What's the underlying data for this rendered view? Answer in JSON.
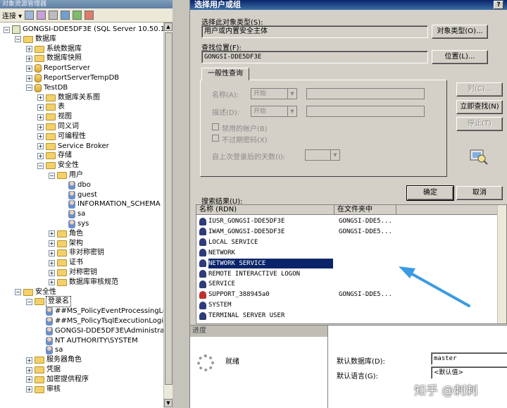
{
  "explorer": {
    "title": "对象资源管理器",
    "toolbar": {
      "connect_label": "连接 ▾"
    },
    "tree": [
      {
        "label": "GONGSI-DDE5DF3E (SQL Server 10.50.160",
        "level": 0,
        "expander": "-",
        "icon": "server"
      },
      {
        "label": "数据库",
        "level": 1,
        "expander": "-",
        "icon": "folder"
      },
      {
        "label": "系统数据库",
        "level": 2,
        "expander": "+",
        "icon": "folder"
      },
      {
        "label": "数据库快照",
        "level": 2,
        "expander": "+",
        "icon": "folder"
      },
      {
        "label": "ReportServer",
        "level": 2,
        "expander": "+",
        "icon": "database"
      },
      {
        "label": "ReportServerTempDB",
        "level": 2,
        "expander": "+",
        "icon": "database"
      },
      {
        "label": "TestDB",
        "level": 2,
        "expander": "-",
        "icon": "database"
      },
      {
        "label": "数据库关系图",
        "level": 3,
        "expander": "+",
        "icon": "folder"
      },
      {
        "label": "表",
        "level": 3,
        "expander": "+",
        "icon": "folder"
      },
      {
        "label": "视图",
        "level": 3,
        "expander": "+",
        "icon": "folder"
      },
      {
        "label": "同义词",
        "level": 3,
        "expander": "+",
        "icon": "folder"
      },
      {
        "label": "可编程性",
        "level": 3,
        "expander": "+",
        "icon": "folder"
      },
      {
        "label": "Service Broker",
        "level": 3,
        "expander": "+",
        "icon": "folder"
      },
      {
        "label": "存储",
        "level": 3,
        "expander": "+",
        "icon": "folder"
      },
      {
        "label": "安全性",
        "level": 3,
        "expander": "-",
        "icon": "folder"
      },
      {
        "label": "用户",
        "level": 4,
        "expander": "-",
        "icon": "folder"
      },
      {
        "label": "dbo",
        "level": 5,
        "expander": "",
        "icon": "user"
      },
      {
        "label": "guest",
        "level": 5,
        "expander": "",
        "icon": "user"
      },
      {
        "label": "INFORMATION_SCHEMA",
        "level": 5,
        "expander": "",
        "icon": "user"
      },
      {
        "label": "sa",
        "level": 5,
        "expander": "",
        "icon": "user"
      },
      {
        "label": "sys",
        "level": 5,
        "expander": "",
        "icon": "user"
      },
      {
        "label": "角色",
        "level": 4,
        "expander": "+",
        "icon": "folder"
      },
      {
        "label": "架构",
        "level": 4,
        "expander": "+",
        "icon": "folder"
      },
      {
        "label": "非对称密钥",
        "level": 4,
        "expander": "+",
        "icon": "folder"
      },
      {
        "label": "证书",
        "level": 4,
        "expander": "+",
        "icon": "folder"
      },
      {
        "label": "对称密钥",
        "level": 4,
        "expander": "+",
        "icon": "folder"
      },
      {
        "label": "数据库审核规范",
        "level": 4,
        "expander": "+",
        "icon": "folder"
      },
      {
        "label": "安全性",
        "level": 1,
        "expander": "-",
        "icon": "folder"
      },
      {
        "label": "登录名",
        "level": 2,
        "expander": "-",
        "icon": "folder",
        "selected": true
      },
      {
        "label": "##MS_PolicyEventProcessingLo",
        "level": 3,
        "expander": "",
        "icon": "user"
      },
      {
        "label": "##MS_PolicyTsqlExecutionLogi",
        "level": 3,
        "expander": "",
        "icon": "user"
      },
      {
        "label": "GONGSI-DDE5DF3E\\Administrato",
        "level": 3,
        "expander": "",
        "icon": "user"
      },
      {
        "label": "NT AUTHORITY\\SYSTEM",
        "level": 3,
        "expander": "",
        "icon": "user"
      },
      {
        "label": "sa",
        "level": 3,
        "expander": "",
        "icon": "user"
      },
      {
        "label": "服务器角色",
        "level": 2,
        "expander": "+",
        "icon": "folder"
      },
      {
        "label": "凭据",
        "level": 2,
        "expander": "+",
        "icon": "folder"
      },
      {
        "label": "加密提供程序",
        "level": 2,
        "expander": "+",
        "icon": "folder"
      },
      {
        "label": "审核",
        "level": 2,
        "expander": "+",
        "icon": "folder"
      }
    ]
  },
  "dialog": {
    "title": "选择用户或组",
    "help_label": "?",
    "object_type_label": "选择此对象类型(S):",
    "object_type_value": "用户或内置安全主体",
    "object_type_button": "对象类型(O)...",
    "location_label": "查找位置(F):",
    "location_value": "GONGSI-DDE5DF3E",
    "location_button": "位置(L)...",
    "tab_label": "一般性查询",
    "name_label": "名称(A):",
    "desc_label": "描述(D):",
    "starts_with": "开始",
    "disabled_accounts": "禁用的帐户(B)",
    "non_expiring": "不过期密码(X)",
    "days_since_logon": "自上次登录后的天数(I):",
    "columns_button": "列(C)...",
    "find_now_button": "立即查找(N)",
    "stop_button": "停止(T)",
    "ok_button": "确定",
    "cancel_button": "取消",
    "results_label": "搜索结果(U):",
    "results_headers": [
      "名称 (RDN)",
      "在文件夹中"
    ],
    "results": [
      {
        "name": "IUSR_GONGSI-DDE5DF3E",
        "folder": "GONGSI-DDE5...",
        "icon": "user"
      },
      {
        "name": "IWAM_GONGSI-DDE5DF3E",
        "folder": "GONGSI-DDE5...",
        "icon": "user"
      },
      {
        "name": "LOCAL SERVICE",
        "folder": "",
        "icon": "user"
      },
      {
        "name": "NETWORK",
        "folder": "",
        "icon": "user"
      },
      {
        "name": "NETWORK SERVICE",
        "folder": "",
        "icon": "user",
        "selected": true
      },
      {
        "name": "REMOTE INTERACTIVE LOGON",
        "folder": "",
        "icon": "user"
      },
      {
        "name": "SERVICE",
        "folder": "",
        "icon": "user"
      },
      {
        "name": "SUPPORT_388945a0",
        "folder": "GONGSI-DDE5...",
        "icon": "user-red"
      },
      {
        "name": "SYSTEM",
        "folder": "",
        "icon": "user"
      },
      {
        "name": "TERMINAL SERVER USER",
        "folder": "",
        "icon": "user"
      }
    ]
  },
  "progress": {
    "title": "进度",
    "status": "就绪"
  },
  "login_props": {
    "default_db_label": "默认数据库(D):",
    "default_db_value": "master",
    "default_lang_label": "默认语言(G):",
    "default_lang_value": "<默认值>"
  },
  "watermark": "知乎 @刺刺",
  "colors": {
    "selection": "#0a246a",
    "annotation_arrow": "#3b9be0",
    "window_bg": "#d4d0c8"
  }
}
